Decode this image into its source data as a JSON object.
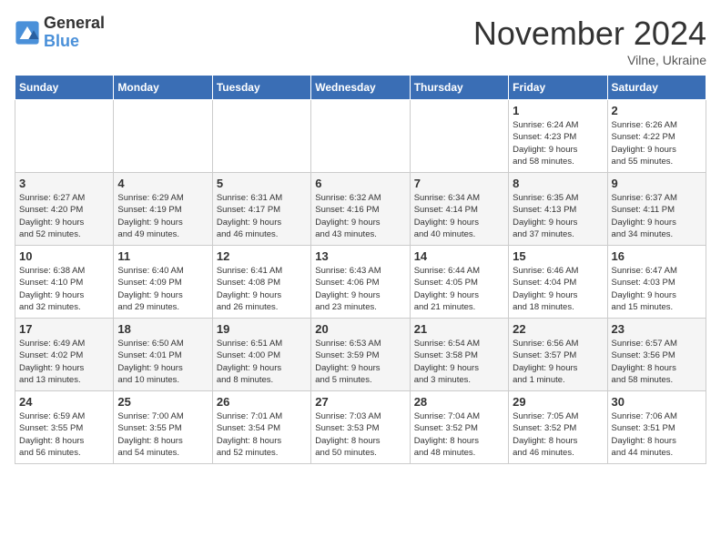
{
  "logo": {
    "general": "General",
    "blue": "Blue"
  },
  "title": "November 2024",
  "location": "Vilne, Ukraine",
  "weekdays": [
    "Sunday",
    "Monday",
    "Tuesday",
    "Wednesday",
    "Thursday",
    "Friday",
    "Saturday"
  ],
  "weeks": [
    [
      {
        "day": "",
        "info": ""
      },
      {
        "day": "",
        "info": ""
      },
      {
        "day": "",
        "info": ""
      },
      {
        "day": "",
        "info": ""
      },
      {
        "day": "",
        "info": ""
      },
      {
        "day": "1",
        "info": "Sunrise: 6:24 AM\nSunset: 4:23 PM\nDaylight: 9 hours\nand 58 minutes."
      },
      {
        "day": "2",
        "info": "Sunrise: 6:26 AM\nSunset: 4:22 PM\nDaylight: 9 hours\nand 55 minutes."
      }
    ],
    [
      {
        "day": "3",
        "info": "Sunrise: 6:27 AM\nSunset: 4:20 PM\nDaylight: 9 hours\nand 52 minutes."
      },
      {
        "day": "4",
        "info": "Sunrise: 6:29 AM\nSunset: 4:19 PM\nDaylight: 9 hours\nand 49 minutes."
      },
      {
        "day": "5",
        "info": "Sunrise: 6:31 AM\nSunset: 4:17 PM\nDaylight: 9 hours\nand 46 minutes."
      },
      {
        "day": "6",
        "info": "Sunrise: 6:32 AM\nSunset: 4:16 PM\nDaylight: 9 hours\nand 43 minutes."
      },
      {
        "day": "7",
        "info": "Sunrise: 6:34 AM\nSunset: 4:14 PM\nDaylight: 9 hours\nand 40 minutes."
      },
      {
        "day": "8",
        "info": "Sunrise: 6:35 AM\nSunset: 4:13 PM\nDaylight: 9 hours\nand 37 minutes."
      },
      {
        "day": "9",
        "info": "Sunrise: 6:37 AM\nSunset: 4:11 PM\nDaylight: 9 hours\nand 34 minutes."
      }
    ],
    [
      {
        "day": "10",
        "info": "Sunrise: 6:38 AM\nSunset: 4:10 PM\nDaylight: 9 hours\nand 32 minutes."
      },
      {
        "day": "11",
        "info": "Sunrise: 6:40 AM\nSunset: 4:09 PM\nDaylight: 9 hours\nand 29 minutes."
      },
      {
        "day": "12",
        "info": "Sunrise: 6:41 AM\nSunset: 4:08 PM\nDaylight: 9 hours\nand 26 minutes."
      },
      {
        "day": "13",
        "info": "Sunrise: 6:43 AM\nSunset: 4:06 PM\nDaylight: 9 hours\nand 23 minutes."
      },
      {
        "day": "14",
        "info": "Sunrise: 6:44 AM\nSunset: 4:05 PM\nDaylight: 9 hours\nand 21 minutes."
      },
      {
        "day": "15",
        "info": "Sunrise: 6:46 AM\nSunset: 4:04 PM\nDaylight: 9 hours\nand 18 minutes."
      },
      {
        "day": "16",
        "info": "Sunrise: 6:47 AM\nSunset: 4:03 PM\nDaylight: 9 hours\nand 15 minutes."
      }
    ],
    [
      {
        "day": "17",
        "info": "Sunrise: 6:49 AM\nSunset: 4:02 PM\nDaylight: 9 hours\nand 13 minutes."
      },
      {
        "day": "18",
        "info": "Sunrise: 6:50 AM\nSunset: 4:01 PM\nDaylight: 9 hours\nand 10 minutes."
      },
      {
        "day": "19",
        "info": "Sunrise: 6:51 AM\nSunset: 4:00 PM\nDaylight: 9 hours\nand 8 minutes."
      },
      {
        "day": "20",
        "info": "Sunrise: 6:53 AM\nSunset: 3:59 PM\nDaylight: 9 hours\nand 5 minutes."
      },
      {
        "day": "21",
        "info": "Sunrise: 6:54 AM\nSunset: 3:58 PM\nDaylight: 9 hours\nand 3 minutes."
      },
      {
        "day": "22",
        "info": "Sunrise: 6:56 AM\nSunset: 3:57 PM\nDaylight: 9 hours\nand 1 minute."
      },
      {
        "day": "23",
        "info": "Sunrise: 6:57 AM\nSunset: 3:56 PM\nDaylight: 8 hours\nand 58 minutes."
      }
    ],
    [
      {
        "day": "24",
        "info": "Sunrise: 6:59 AM\nSunset: 3:55 PM\nDaylight: 8 hours\nand 56 minutes."
      },
      {
        "day": "25",
        "info": "Sunrise: 7:00 AM\nSunset: 3:55 PM\nDaylight: 8 hours\nand 54 minutes."
      },
      {
        "day": "26",
        "info": "Sunrise: 7:01 AM\nSunset: 3:54 PM\nDaylight: 8 hours\nand 52 minutes."
      },
      {
        "day": "27",
        "info": "Sunrise: 7:03 AM\nSunset: 3:53 PM\nDaylight: 8 hours\nand 50 minutes."
      },
      {
        "day": "28",
        "info": "Sunrise: 7:04 AM\nSunset: 3:52 PM\nDaylight: 8 hours\nand 48 minutes."
      },
      {
        "day": "29",
        "info": "Sunrise: 7:05 AM\nSunset: 3:52 PM\nDaylight: 8 hours\nand 46 minutes."
      },
      {
        "day": "30",
        "info": "Sunrise: 7:06 AM\nSunset: 3:51 PM\nDaylight: 8 hours\nand 44 minutes."
      }
    ]
  ]
}
